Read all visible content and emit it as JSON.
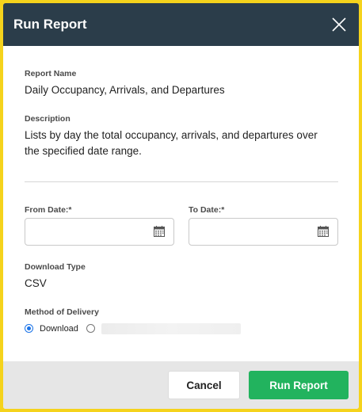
{
  "dialog": {
    "title": "Run Report",
    "close_icon": "close-icon"
  },
  "report": {
    "name_label": "Report Name",
    "name": "Daily Occupancy, Arrivals, and Departures",
    "description_label": "Description",
    "description_line1": "Lists by day the total occupancy, arrivals, and departures over",
    "description_line2": "the specified date range."
  },
  "dates": {
    "from_label": "From Date:*",
    "from_value": "",
    "to_label": "To Date:*",
    "to_value": "",
    "calendar_icon": "calendar-icon"
  },
  "download": {
    "label": "Download Type",
    "value": "CSV"
  },
  "delivery": {
    "label": "Method of Delivery",
    "options": [
      {
        "label": "Download",
        "selected": true
      },
      {
        "label": "",
        "selected": false
      }
    ]
  },
  "footer": {
    "cancel_label": "Cancel",
    "run_label": "Run Report"
  },
  "colors": {
    "backdrop": "#f5d31c",
    "header": "#2b3d4a",
    "primary_button": "#22b35e",
    "radio_accent": "#1a73e8"
  }
}
